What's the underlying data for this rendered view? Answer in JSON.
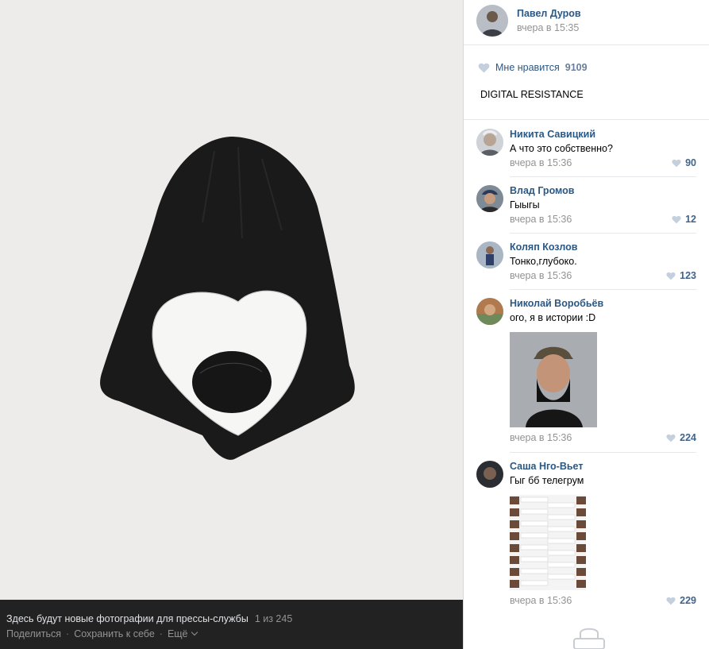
{
  "viewer": {
    "caption": "Здесь будут новые фотографии для прессы-службы",
    "counter": "1 из 245",
    "actions": {
      "share": "Поделиться",
      "save": "Сохранить к себе",
      "more": "Ещё"
    }
  },
  "post": {
    "author": "Павел Дуров",
    "date": "вчера в 15:35",
    "likes_label": "Мне нравится",
    "likes_count": "9109",
    "text": "DIGITAL RESISTANCE"
  },
  "comments": [
    {
      "name": "Никита Савицкий",
      "text": "А что это собственно?",
      "date": "вчера в 15:36",
      "likes": "90"
    },
    {
      "name": "Влад Громов",
      "text": "Гыыгы",
      "date": "вчера в 15:36",
      "likes": "12"
    },
    {
      "name": "Коляп Козлов",
      "text": "Тонко,глубоко.",
      "date": "вчера в 15:36",
      "likes": "123"
    },
    {
      "name": "Николай Воробьёв",
      "text": "ого, я в истории :D",
      "date": "вчера в 15:36",
      "likes": "224"
    },
    {
      "name": "Саша Нго-Вьет",
      "text": "Гыг бб телегрум",
      "date": "вчера в 15:36",
      "likes": "229"
    }
  ],
  "colors": {
    "link": "#2a5885",
    "muted": "#939393",
    "heart": "#c4d0de",
    "viewer_bg": "#222222"
  },
  "icons": [
    "heart-icon",
    "chevron-down-icon",
    "lock-icon"
  ]
}
